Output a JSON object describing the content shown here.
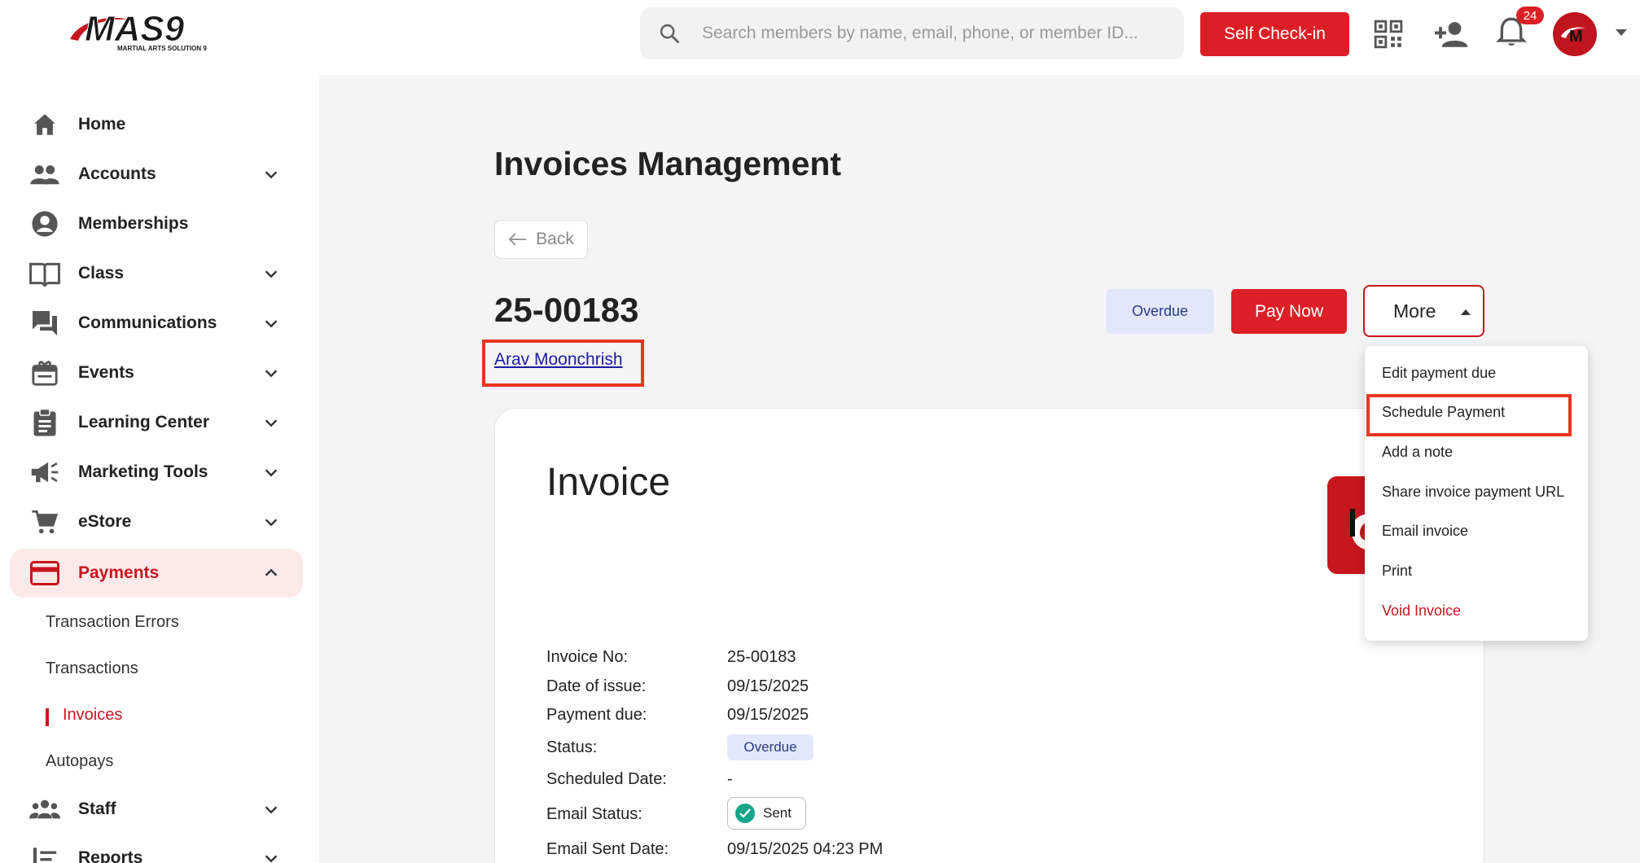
{
  "header": {
    "logo_text": "MAS9",
    "logo_subtext": "MARTIAL ARTS SOLUTION 9",
    "search_placeholder": "Search members by name, email, phone, or member ID...",
    "self_checkin_label": "Self Check-in",
    "notification_count": "24"
  },
  "sidebar": {
    "items": [
      {
        "label": "Home",
        "icon": "home-icon",
        "has_chevron": false
      },
      {
        "label": "Accounts",
        "icon": "people-icon",
        "has_chevron": true
      },
      {
        "label": "Memberships",
        "icon": "account-circle-icon",
        "has_chevron": false
      },
      {
        "label": "Class",
        "icon": "book-icon",
        "has_chevron": true
      },
      {
        "label": "Communications",
        "icon": "chat-icon",
        "has_chevron": true
      },
      {
        "label": "Events",
        "icon": "calendar-gift-icon",
        "has_chevron": true
      },
      {
        "label": "Learning Center",
        "icon": "clipboard-icon",
        "has_chevron": true
      },
      {
        "label": "Marketing Tools",
        "icon": "megaphone-icon",
        "has_chevron": true
      },
      {
        "label": "eStore",
        "icon": "cart-icon",
        "has_chevron": true
      },
      {
        "label": "Payments",
        "icon": "credit-card-icon",
        "has_chevron": true,
        "active": true
      },
      {
        "label": "Staff",
        "icon": "group-icon",
        "has_chevron": true
      },
      {
        "label": "Reports",
        "icon": "list-icon",
        "has_chevron": true
      }
    ],
    "payments_sub": [
      {
        "label": "Transaction Errors"
      },
      {
        "label": "Transactions"
      },
      {
        "label": "Invoices",
        "active": true
      },
      {
        "label": "Autopays"
      }
    ]
  },
  "main": {
    "page_title": "Invoices Management",
    "back_label": "Back",
    "invoice_number": "25-00183",
    "member_name": "Arav Moonchrish",
    "status_badge": "Overdue",
    "pay_now_label": "Pay Now",
    "more_label": "More",
    "card_title": "Invoice",
    "fields": [
      {
        "label": "Invoice No:",
        "value": "25-00183"
      },
      {
        "label": "Date of issue:",
        "value": "09/15/2025"
      },
      {
        "label": "Payment due:",
        "value": "09/15/2025"
      },
      {
        "label": "Status:",
        "value": "Overdue"
      },
      {
        "label": "Scheduled Date:",
        "value": "-"
      },
      {
        "label": "Email Status:",
        "value": "Sent"
      },
      {
        "label": "Email Sent Date:",
        "value": "09/15/2025 04:23 PM"
      }
    ]
  },
  "more_menu": [
    {
      "label": "Edit payment due"
    },
    {
      "label": "Schedule Payment",
      "highlighted": true
    },
    {
      "label": "Add a note"
    },
    {
      "label": "Share invoice payment URL"
    },
    {
      "label": "Email invoice"
    },
    {
      "label": "Print"
    },
    {
      "label": "Void Invoice",
      "danger": true
    }
  ],
  "colors": {
    "brand_red": "#dc1f26",
    "highlight_box": "#e8351f",
    "overdue_bg": "#e3e7fb",
    "sent_check": "#17a58b"
  }
}
